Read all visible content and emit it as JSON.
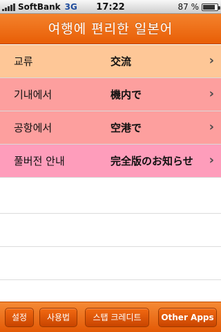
{
  "status_bar": {
    "carrier": "SoftBank",
    "network": "3G",
    "time": "17:22",
    "battery_percent_text": "87 %",
    "battery_level": 0.87
  },
  "nav": {
    "title": "여행에 편리한 일본어"
  },
  "rows": [
    {
      "korean": "교류",
      "japanese": "交流",
      "color": "#fec797"
    },
    {
      "korean": "기내에서",
      "japanese": "機内で",
      "color": "#fd9f9e"
    },
    {
      "korean": "공항에서",
      "japanese": "空港で",
      "color": "#fd9f9e"
    },
    {
      "korean": "풀버전 안내",
      "japanese": "完全版のお知らせ",
      "color": "#fe9dbb"
    }
  ],
  "toolbar": {
    "settings_label": "설정",
    "howto_label": "사용법",
    "credits_label": "스탭 크레디트",
    "other_apps_label": "Other Apps"
  },
  "colors": {
    "accent": "#ee6a12"
  }
}
